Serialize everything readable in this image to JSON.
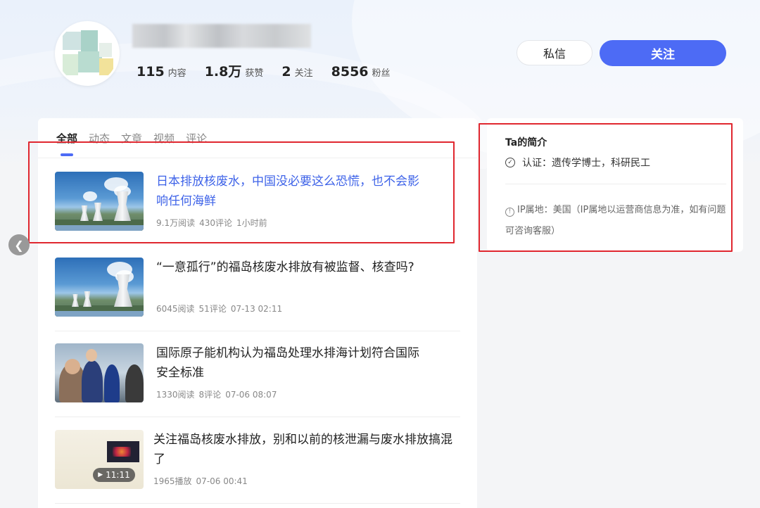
{
  "profile": {
    "avatar_icon": "avatar",
    "stats": [
      {
        "value": "115",
        "label": "内容"
      },
      {
        "value": "1.8万",
        "label": "获赞"
      },
      {
        "value": "2",
        "label": "关注"
      },
      {
        "value": "8556",
        "label": "粉丝"
      }
    ],
    "message_button": "私信",
    "follow_button": "关注"
  },
  "tabs": [
    {
      "label": "全部"
    },
    {
      "label": "动态"
    },
    {
      "label": "文章"
    },
    {
      "label": "视频"
    },
    {
      "label": "评论"
    }
  ],
  "articles": [
    {
      "title": "日本排放核废水，中国没必要这么恐慌，也不会影响任何海鲜",
      "reads": "9.1万阅读",
      "comments": "430评论",
      "time": "1小时前"
    },
    {
      "title": "“一意孤行”的福岛核废水排放有被监督、核查吗?",
      "reads": "6045阅读",
      "comments": "51评论",
      "time": "07-13 02:11"
    },
    {
      "title": "国际原子能机构认为福岛处理水排海计划符合国际安全标准",
      "reads": "1330阅读",
      "comments": "8评论",
      "time": "07-06 08:07"
    },
    {
      "title": "关注福岛核废水排放，别和以前的核泄漏与废水排放搞混了",
      "reads": "1965播放",
      "comments": "",
      "time": "07-06 00:41",
      "duration": "11:11"
    }
  ],
  "sidebar": {
    "title": "Ta的简介",
    "certification": "认证：遗传学博士，科研民工",
    "ip_text": "IP属地：美国（IP属地以运营商信息为准，如有问题可咨询客服）"
  },
  "colors": {
    "accent": "#4d6bf5",
    "highlight_border": "#e0272f",
    "link_active": "#3d62e8"
  }
}
